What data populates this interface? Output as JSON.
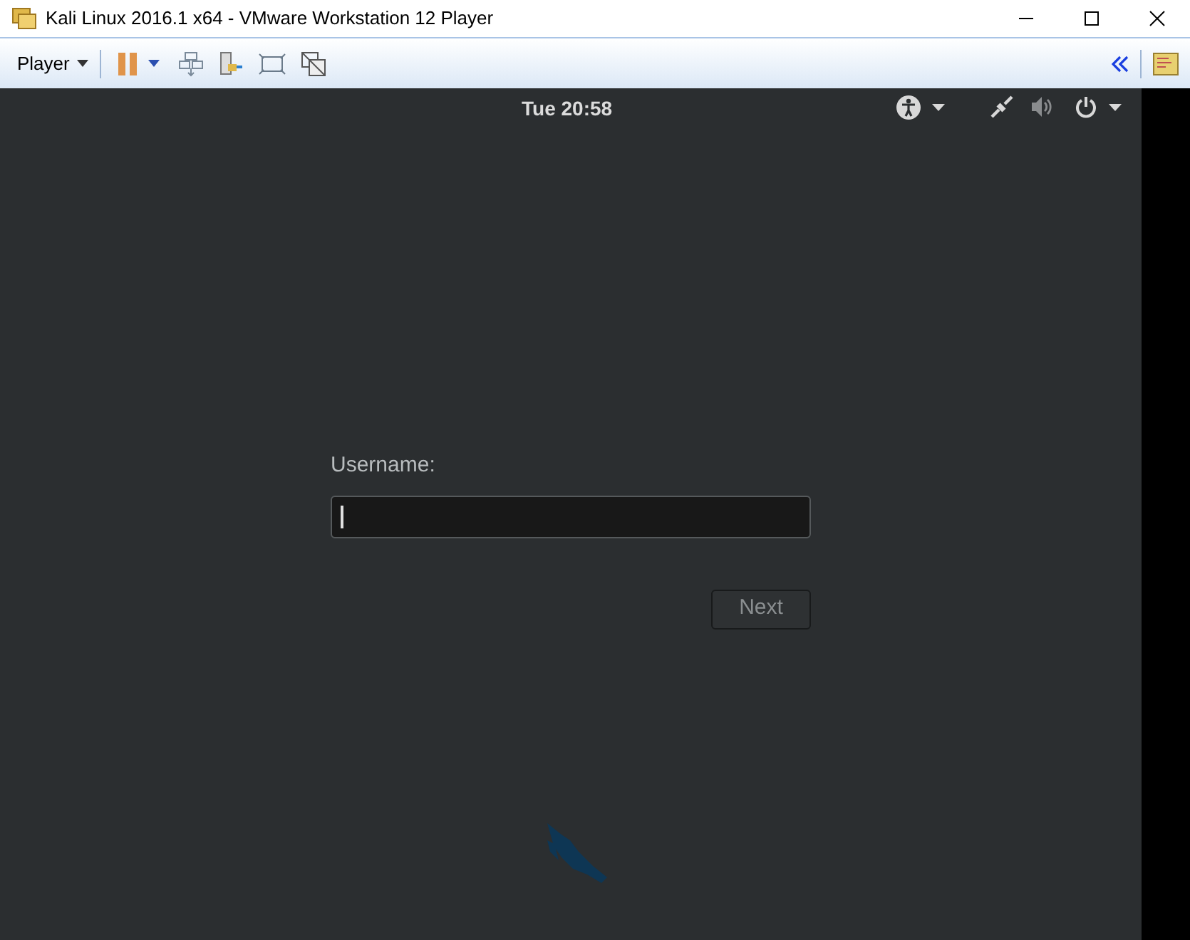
{
  "window": {
    "title": "Kali Linux 2016.1 x64 - VMware Workstation 12 Player"
  },
  "toolbar": {
    "player_menu": "Player"
  },
  "top_bar": {
    "clock": "Tue 20:58"
  },
  "login": {
    "label": "Username:",
    "next_button": {
      "label": "Next",
      "disabled": true
    }
  }
}
